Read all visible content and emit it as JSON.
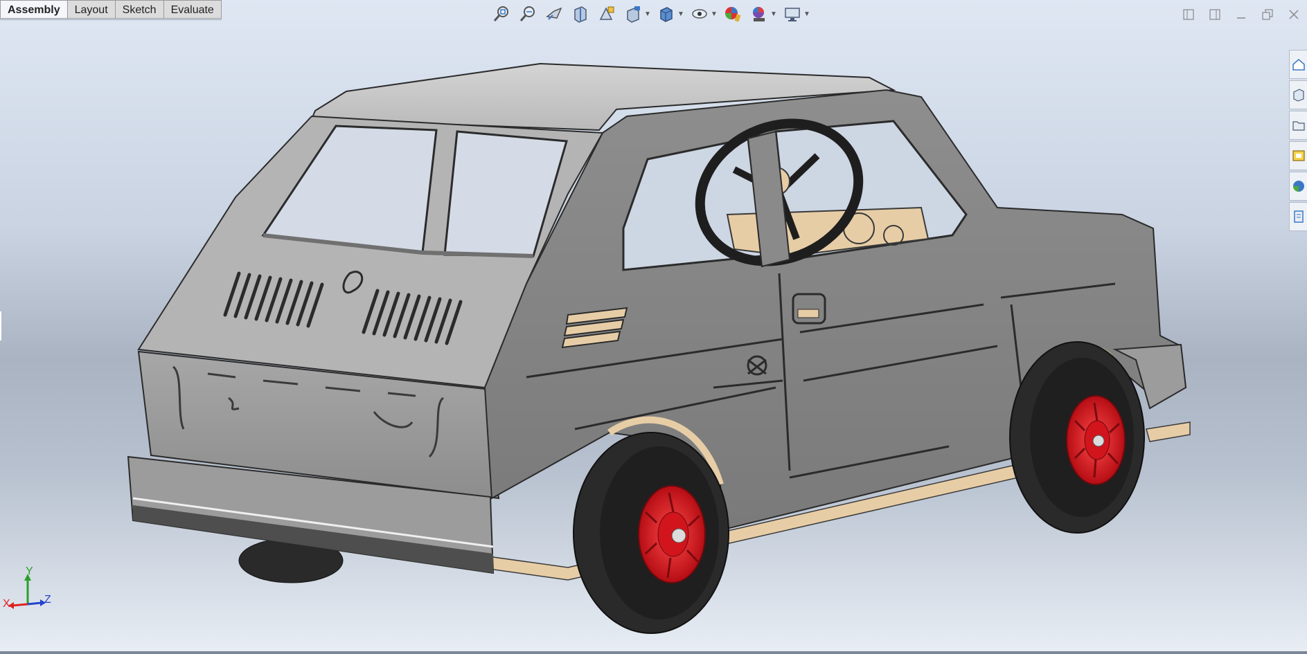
{
  "tabs": [
    {
      "label": "Assembly",
      "active": true
    },
    {
      "label": "Layout",
      "active": false
    },
    {
      "label": "Sketch",
      "active": false
    },
    {
      "label": "Evaluate",
      "active": false
    }
  ],
  "heads_up_toolbar": [
    "zoom-to-fit-icon",
    "zoom-to-area-icon",
    "previous-view-icon",
    "section-view-icon",
    "dynamic-annotation-icon",
    "view-orientation-icon",
    "display-style-icon",
    "hide-show-items-icon",
    "edit-appearance-icon",
    "apply-scene-icon",
    "view-settings-icon"
  ],
  "task_pane": [
    "home-icon",
    "design-library-icon",
    "file-explorer-icon",
    "view-palette-icon",
    "appearances-icon",
    "custom-properties-icon"
  ],
  "triad": {
    "x": "X",
    "y": "Y",
    "z": "Z"
  },
  "colors": {
    "body_gray": "#8a8a8a",
    "wheel_red": "#d2141c",
    "tire_black": "#2a2a2a",
    "wood": "#e7cda6",
    "accent_blue": "#3b78c4"
  }
}
